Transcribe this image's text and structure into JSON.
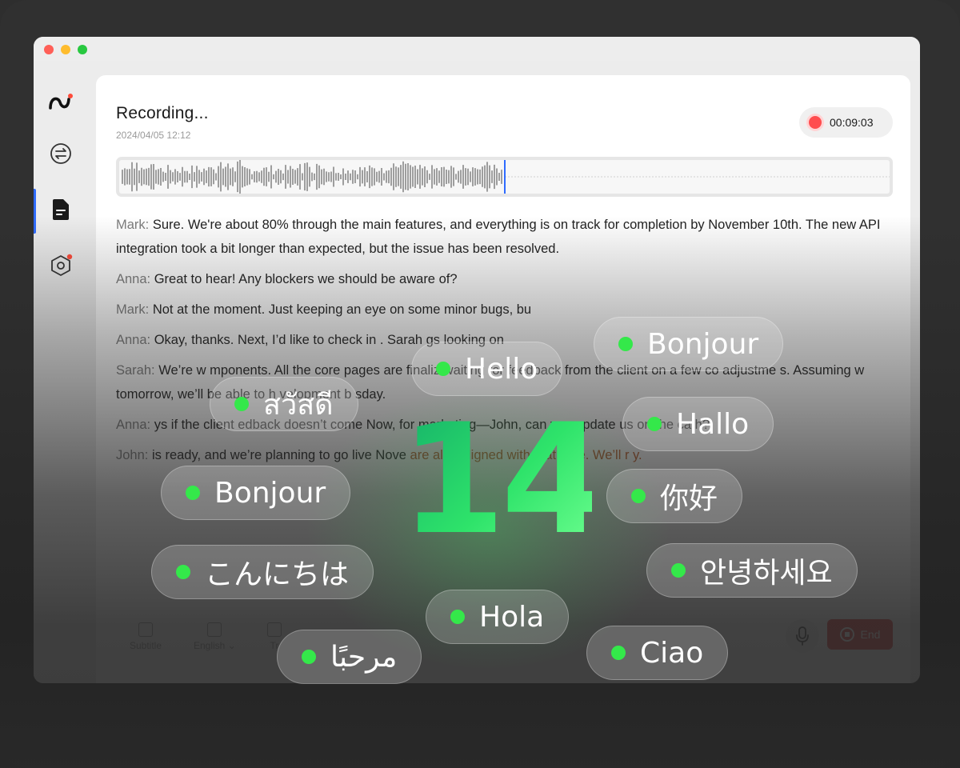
{
  "recording": {
    "title": "Recording...",
    "date": "2024/04/05   12:12",
    "timer": "00:09:03"
  },
  "waveform": {
    "progress": 0.5
  },
  "transcript": [
    {
      "speaker": "Mark:",
      "text": " Sure. We're about 80% through the main features, and everything is on track for completion by November 10th. The new API integration took a bit longer than expected, but the issue has been resolved."
    },
    {
      "speaker": "Anna:",
      "text": " Great to hear! Any blockers we should be aware of?"
    },
    {
      "speaker": "Mark:",
      "text": " Not at the moment. Just keeping an eye on some minor bugs, bu"
    },
    {
      "speaker": "Anna:",
      "text": " Okay, thanks. Next, I’d like to check in . Sarah gs looking on"
    },
    {
      "speaker": "Sarah:",
      "text": " We’re w mponents. All the core pages are finaliz waiting for feedback from the client on a few co adjustme s. Assuming w tomorrow, we’ll be able to h velopment b sday."
    },
    {
      "speaker": "Anna:",
      "text": " ys if the client edback doesn’t come Now, for marketing—John, can you update us on the ca h?"
    },
    {
      "speaker": "John:",
      "text": " is ready, and we’re planning to go live Nove",
      "highlight": " are also aligned with that date. We’ll r y."
    }
  ],
  "toolbar": {
    "subtitle": "Subtitle",
    "language": "English ⌄",
    "translate": "Tr",
    "end": "End"
  },
  "overlay": {
    "count": "14",
    "greetings": [
      "Bonjour",
      "Hello",
      "สวัสดี",
      "Hallo",
      "Bonjour",
      "你好",
      "こんにちは",
      "안녕하세요",
      "Hola",
      "مرحبًا",
      "Ciao"
    ]
  },
  "colors": {
    "accent": "#2f6bff",
    "record_red": "#ff4d4f",
    "end_button": "#e45656",
    "bubble_dot": "#34e84a",
    "number_gradient_start": "#15b06a",
    "number_gradient_end": "#6dff8f"
  }
}
